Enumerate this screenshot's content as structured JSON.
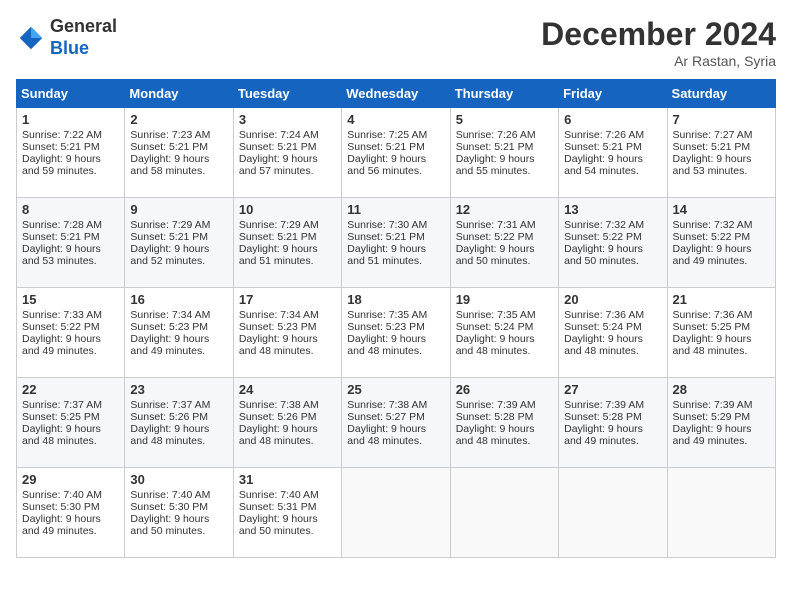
{
  "header": {
    "logo_line1": "General",
    "logo_line2": "Blue",
    "month_title": "December 2024",
    "location": "Ar Rastan, Syria"
  },
  "days_of_week": [
    "Sunday",
    "Monday",
    "Tuesday",
    "Wednesday",
    "Thursday",
    "Friday",
    "Saturday"
  ],
  "weeks": [
    [
      {
        "day": "1",
        "lines": [
          "Sunrise: 7:22 AM",
          "Sunset: 5:21 PM",
          "Daylight: 9 hours",
          "and 59 minutes."
        ]
      },
      {
        "day": "2",
        "lines": [
          "Sunrise: 7:23 AM",
          "Sunset: 5:21 PM",
          "Daylight: 9 hours",
          "and 58 minutes."
        ]
      },
      {
        "day": "3",
        "lines": [
          "Sunrise: 7:24 AM",
          "Sunset: 5:21 PM",
          "Daylight: 9 hours",
          "and 57 minutes."
        ]
      },
      {
        "day": "4",
        "lines": [
          "Sunrise: 7:25 AM",
          "Sunset: 5:21 PM",
          "Daylight: 9 hours",
          "and 56 minutes."
        ]
      },
      {
        "day": "5",
        "lines": [
          "Sunrise: 7:26 AM",
          "Sunset: 5:21 PM",
          "Daylight: 9 hours",
          "and 55 minutes."
        ]
      },
      {
        "day": "6",
        "lines": [
          "Sunrise: 7:26 AM",
          "Sunset: 5:21 PM",
          "Daylight: 9 hours",
          "and 54 minutes."
        ]
      },
      {
        "day": "7",
        "lines": [
          "Sunrise: 7:27 AM",
          "Sunset: 5:21 PM",
          "Daylight: 9 hours",
          "and 53 minutes."
        ]
      }
    ],
    [
      {
        "day": "8",
        "lines": [
          "Sunrise: 7:28 AM",
          "Sunset: 5:21 PM",
          "Daylight: 9 hours",
          "and 53 minutes."
        ]
      },
      {
        "day": "9",
        "lines": [
          "Sunrise: 7:29 AM",
          "Sunset: 5:21 PM",
          "Daylight: 9 hours",
          "and 52 minutes."
        ]
      },
      {
        "day": "10",
        "lines": [
          "Sunrise: 7:29 AM",
          "Sunset: 5:21 PM",
          "Daylight: 9 hours",
          "and 51 minutes."
        ]
      },
      {
        "day": "11",
        "lines": [
          "Sunrise: 7:30 AM",
          "Sunset: 5:21 PM",
          "Daylight: 9 hours",
          "and 51 minutes."
        ]
      },
      {
        "day": "12",
        "lines": [
          "Sunrise: 7:31 AM",
          "Sunset: 5:22 PM",
          "Daylight: 9 hours",
          "and 50 minutes."
        ]
      },
      {
        "day": "13",
        "lines": [
          "Sunrise: 7:32 AM",
          "Sunset: 5:22 PM",
          "Daylight: 9 hours",
          "and 50 minutes."
        ]
      },
      {
        "day": "14",
        "lines": [
          "Sunrise: 7:32 AM",
          "Sunset: 5:22 PM",
          "Daylight: 9 hours",
          "and 49 minutes."
        ]
      }
    ],
    [
      {
        "day": "15",
        "lines": [
          "Sunrise: 7:33 AM",
          "Sunset: 5:22 PM",
          "Daylight: 9 hours",
          "and 49 minutes."
        ]
      },
      {
        "day": "16",
        "lines": [
          "Sunrise: 7:34 AM",
          "Sunset: 5:23 PM",
          "Daylight: 9 hours",
          "and 49 minutes."
        ]
      },
      {
        "day": "17",
        "lines": [
          "Sunrise: 7:34 AM",
          "Sunset: 5:23 PM",
          "Daylight: 9 hours",
          "and 48 minutes."
        ]
      },
      {
        "day": "18",
        "lines": [
          "Sunrise: 7:35 AM",
          "Sunset: 5:23 PM",
          "Daylight: 9 hours",
          "and 48 minutes."
        ]
      },
      {
        "day": "19",
        "lines": [
          "Sunrise: 7:35 AM",
          "Sunset: 5:24 PM",
          "Daylight: 9 hours",
          "and 48 minutes."
        ]
      },
      {
        "day": "20",
        "lines": [
          "Sunrise: 7:36 AM",
          "Sunset: 5:24 PM",
          "Daylight: 9 hours",
          "and 48 minutes."
        ]
      },
      {
        "day": "21",
        "lines": [
          "Sunrise: 7:36 AM",
          "Sunset: 5:25 PM",
          "Daylight: 9 hours",
          "and 48 minutes."
        ]
      }
    ],
    [
      {
        "day": "22",
        "lines": [
          "Sunrise: 7:37 AM",
          "Sunset: 5:25 PM",
          "Daylight: 9 hours",
          "and 48 minutes."
        ]
      },
      {
        "day": "23",
        "lines": [
          "Sunrise: 7:37 AM",
          "Sunset: 5:26 PM",
          "Daylight: 9 hours",
          "and 48 minutes."
        ]
      },
      {
        "day": "24",
        "lines": [
          "Sunrise: 7:38 AM",
          "Sunset: 5:26 PM",
          "Daylight: 9 hours",
          "and 48 minutes."
        ]
      },
      {
        "day": "25",
        "lines": [
          "Sunrise: 7:38 AM",
          "Sunset: 5:27 PM",
          "Daylight: 9 hours",
          "and 48 minutes."
        ]
      },
      {
        "day": "26",
        "lines": [
          "Sunrise: 7:39 AM",
          "Sunset: 5:28 PM",
          "Daylight: 9 hours",
          "and 48 minutes."
        ]
      },
      {
        "day": "27",
        "lines": [
          "Sunrise: 7:39 AM",
          "Sunset: 5:28 PM",
          "Daylight: 9 hours",
          "and 49 minutes."
        ]
      },
      {
        "day": "28",
        "lines": [
          "Sunrise: 7:39 AM",
          "Sunset: 5:29 PM",
          "Daylight: 9 hours",
          "and 49 minutes."
        ]
      }
    ],
    [
      {
        "day": "29",
        "lines": [
          "Sunrise: 7:40 AM",
          "Sunset: 5:30 PM",
          "Daylight: 9 hours",
          "and 49 minutes."
        ]
      },
      {
        "day": "30",
        "lines": [
          "Sunrise: 7:40 AM",
          "Sunset: 5:30 PM",
          "Daylight: 9 hours",
          "and 50 minutes."
        ]
      },
      {
        "day": "31",
        "lines": [
          "Sunrise: 7:40 AM",
          "Sunset: 5:31 PM",
          "Daylight: 9 hours",
          "and 50 minutes."
        ]
      },
      null,
      null,
      null,
      null
    ]
  ]
}
